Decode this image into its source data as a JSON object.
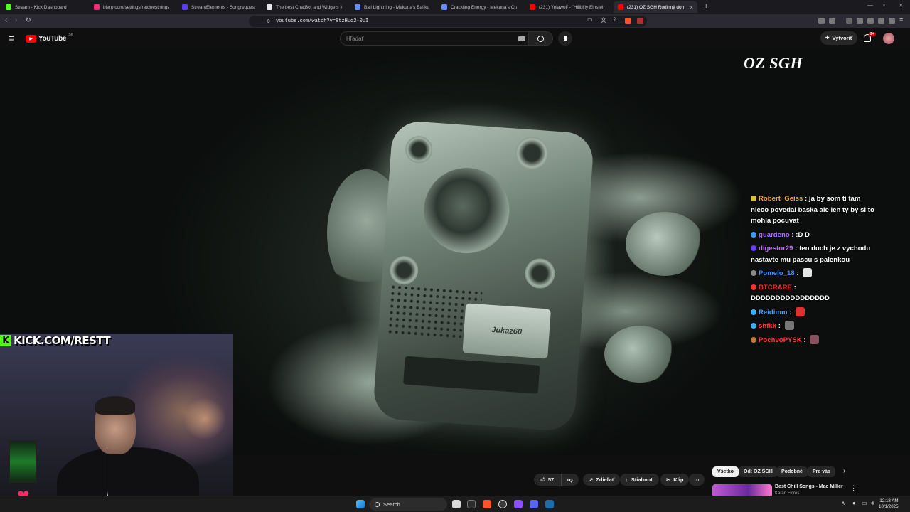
{
  "tabs": [
    {
      "title": "Stream - Kick Dashboard",
      "color": "#53fc18"
    },
    {
      "title": "blerp.com/settings/retdoesthings",
      "color": "#ff2d7a"
    },
    {
      "title": "StreamElements - Songrequest",
      "color": "#5a3cff"
    },
    {
      "title": "The best ChatBot and Widgets for K",
      "color": "#e8e8e8"
    },
    {
      "title": "Ball Lightning - Mekuna's Ballkuna",
      "color": "#6b8cff"
    },
    {
      "title": "Crackling Energy - Mekuna's Crackur",
      "color": "#6b8cff"
    },
    {
      "title": "(231) Yelawolf - \"Hillbilly Einstein\" (M",
      "color": "#ff0000"
    },
    {
      "title": "(231) OZ SGH Rodinný dom",
      "color": "#ff0000"
    }
  ],
  "browser": {
    "url": "youtube.com/watch?v=8tzHud2-0uI"
  },
  "youtube": {
    "logo": "YouTube",
    "country": "SK",
    "search_placeholder": "Hľadať",
    "create_label": "Vytvoriť",
    "notifications_count": "9+"
  },
  "video": {
    "watermark": "OZ SGH",
    "device_label": "Jukaz60"
  },
  "chat": [
    {
      "user": "Robert_Geiss",
      "color": "#f0a830",
      "text": "ja by som ti tam nieco povedal baska ale len ty by si to mohla pocuvat",
      "badge": "#d9c23a",
      "emote": null
    },
    {
      "user": "guardeno",
      "color": "#b06cff",
      "text": ":D D",
      "badge": "#3aa0ff",
      "emote": null
    },
    {
      "user": "digestor29",
      "color": "#c06cff",
      "text": "ten duch je z vychodu nastavte mu pascu s palenkou",
      "badge": "#6a3cff",
      "emote": null
    },
    {
      "user": "Pomelo_18",
      "color": "#3a8cff",
      "text": "",
      "badge": "#8a8a8a",
      "emote": "#e6e6e6"
    },
    {
      "user": "BTCRARE",
      "color": "#ff3030",
      "text": "DDDDDDDDDDDDDDDD",
      "badge": "#ff3030",
      "emote": null
    },
    {
      "user": "Reidimm",
      "color": "#3aa0ff",
      "text": "",
      "badge": "#3ab0ff",
      "emote": "#e03030"
    },
    {
      "user": "shfkk",
      "color": "#ff3a3a",
      "text": "",
      "badge": "#3ab0ff",
      "emote": "#777777"
    },
    {
      "user": "PochvoPYSK",
      "color": "#ff3a3a",
      "text": "",
      "badge": "#c27a3a",
      "emote": "#8a5060"
    }
  ],
  "webcam": {
    "banner": "KICK.COM/RESTT"
  },
  "actions": {
    "likes": "57",
    "share": "Zdieľať",
    "download": "Stiahnuť",
    "clip": "Klip"
  },
  "filters": [
    "Všetko",
    "Od: OZ SGH",
    "Podobné",
    "Pre vás"
  ],
  "recommendation": {
    "title": "Best Chill Songs - Mac Miller",
    "channel": "Karan Flores"
  },
  "taskbar": {
    "search": "Search",
    "time": "12:18 AM",
    "date": "10/1/2025"
  }
}
